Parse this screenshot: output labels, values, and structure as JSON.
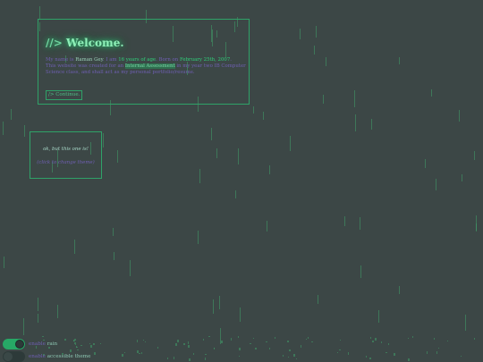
{
  "welcome": {
    "prompt": "//>",
    "title": "Welcome.",
    "bio": {
      "p1": "My name is ",
      "name": "Raman Gey",
      "p2": ". I am ",
      "age": "16 years of age",
      "p3": ". Born on ",
      "birthday": "February 25th, 2007",
      "p4": ".",
      "p5": "This website was created for an ",
      "assessment": "Internal Assessment",
      "p6": " in my year two IB Computer Science class, and shall act as my personal portfolio/resume."
    },
    "continue_label": "/> Continue."
  },
  "secondary": {
    "line1": "ok, but this one is!",
    "line2": "(click to change theme)"
  },
  "toggles": [
    {
      "prefix": "enable",
      "label": "rain",
      "state": "on"
    },
    {
      "prefix": "enable",
      "label": "accessible theme",
      "state": "off"
    }
  ],
  "colors": {
    "background": "#3c4746",
    "accent": "#2fa268",
    "text_purple": "#6f5fb3",
    "rain": "#3f9e6a"
  }
}
